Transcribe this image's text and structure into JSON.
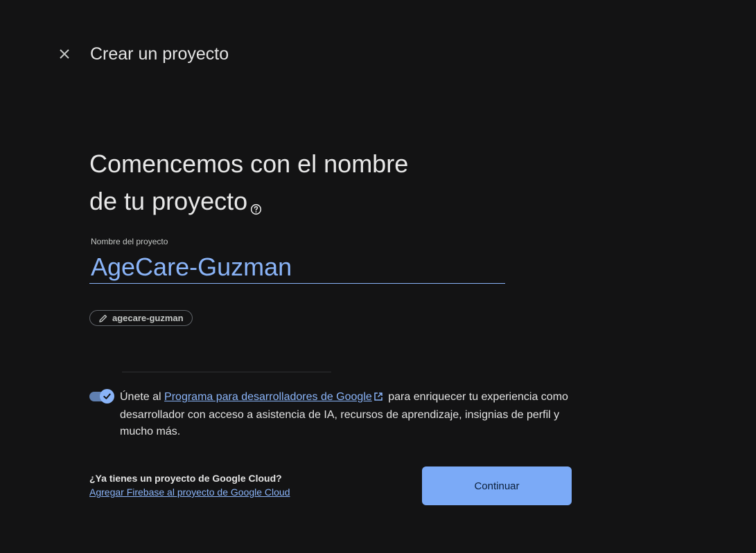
{
  "header": {
    "title": "Crear un proyecto",
    "close_icon": "close-icon"
  },
  "main": {
    "headline_line1": "Comencemos con el nombre",
    "headline_line2": "de tu proyecto",
    "help_icon": "help-icon",
    "project_name": {
      "label": "Nombre del proyecto",
      "value": "AgeCare-Guzman"
    },
    "project_id_chip": {
      "icon": "pencil-icon",
      "value": "agecare-guzman"
    },
    "developer_program": {
      "checked": true,
      "text_before": "Únete al ",
      "link_text": "Programa para desarrolladores de Google",
      "link_icon": "external-link-icon",
      "text_after": " para enriquecer tu experiencia como desarrollador con acceso a asistencia de IA, recursos de aprendizaje, insignias de perfil y mucho más."
    }
  },
  "footer": {
    "question": "¿Ya tienes un proyecto de Google Cloud?",
    "link": "Agregar Firebase al proyecto de Google Cloud",
    "continue_label": "Continuar"
  },
  "colors": {
    "background": "#131314",
    "accent": "#8ab4f8",
    "button": "#7baaf7"
  }
}
